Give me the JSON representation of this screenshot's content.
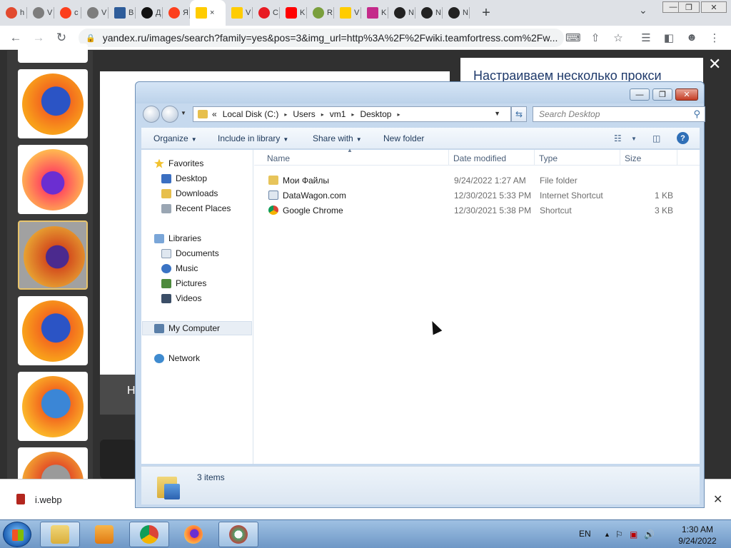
{
  "browser": {
    "tabs": [
      {
        "icon": "habr-icon",
        "label": "h",
        "color": "#e24a2f"
      },
      {
        "icon": "globe-icon",
        "label": "V",
        "color": "#555"
      },
      {
        "icon": "yandex-icon",
        "label": "c",
        "color": "#fc3f1d"
      },
      {
        "icon": "globe-icon",
        "label": "V",
        "color": "#555"
      },
      {
        "icon": "app-icon",
        "label": "B",
        "color": "#2e5c9a"
      },
      {
        "icon": "plus-circle-icon",
        "label": "Д",
        "color": "#111"
      },
      {
        "icon": "yandex-icon",
        "label": "Я",
        "color": "#fc3f1d"
      },
      {
        "icon": "images-icon",
        "label": "×",
        "color": "#ffcc00",
        "active": true
      },
      {
        "icon": "images-icon",
        "label": "V",
        "color": "#ffcc00"
      },
      {
        "icon": "opera-icon",
        "label": "C",
        "color": "#e81b23"
      },
      {
        "icon": "youtube-icon",
        "label": "K",
        "color": "#ff0000"
      },
      {
        "icon": "roblox-icon",
        "label": "R",
        "color": "#7a9f3d"
      },
      {
        "icon": "images-icon",
        "label": "V",
        "color": "#ffcc00"
      },
      {
        "icon": "gl-icon",
        "label": "K",
        "color": "#c42a8a"
      },
      {
        "icon": "github-icon",
        "label": "N",
        "color": "#222"
      },
      {
        "icon": "github-icon",
        "label": "N",
        "color": "#222"
      },
      {
        "icon": "github-icon",
        "label": "N",
        "color": "#222"
      }
    ],
    "new_tab": "+",
    "tab_search": "⌄",
    "window_controls": {
      "minimize": "—",
      "maximize": "❐",
      "close": "✕"
    },
    "nav": {
      "back": "←",
      "forward": "→",
      "reload": "↻"
    },
    "url": "yandex.ru/images/search?family=yes&pos=3&img_url=http%3A%2F%2Fwiki.teamfortress.com%2Fw..."
  },
  "page": {
    "right_title": "Настраиваем несколько прокси",
    "preview_letter": "Н",
    "close_viewer": "✕"
  },
  "download": {
    "file_name": "i.webp",
    "close": "✕"
  },
  "explorer": {
    "caption_buttons": {
      "minimize": "—",
      "maximize": "❐",
      "close": "✕"
    },
    "breadcrumb": {
      "overflow": "«",
      "parts": [
        "Local Disk (C:)",
        "Users",
        "vm1",
        "Desktop"
      ],
      "separator": "▸"
    },
    "search_placeholder": "Search Desktop",
    "commands": {
      "organize": "Organize",
      "include_in_library": "Include in library",
      "share_with": "Share with",
      "new_folder": "New folder"
    },
    "nav_pane": {
      "favorites": "Favorites",
      "desktop": "Desktop",
      "downloads": "Downloads",
      "recent_places": "Recent Places",
      "libraries": "Libraries",
      "documents": "Documents",
      "music": "Music",
      "pictures": "Pictures",
      "videos": "Videos",
      "my_computer": "My Computer",
      "network": "Network"
    },
    "columns": {
      "name": "Name",
      "date": "Date modified",
      "type": "Type",
      "size": "Size"
    },
    "files": [
      {
        "name": "Мои Файлы",
        "date": "9/24/2022 1:27 AM",
        "type": "File folder",
        "size": "",
        "icon": "folder-icon"
      },
      {
        "name": "DataWagon.com",
        "date": "12/30/2021 5:33 PM",
        "type": "Internet Shortcut",
        "size": "1 KB",
        "icon": "internet-shortcut-icon"
      },
      {
        "name": "Google Chrome",
        "date": "12/30/2021 5:38 PM",
        "type": "Shortcut",
        "size": "3 KB",
        "icon": "chrome-shortcut-icon"
      }
    ],
    "status": "3 items"
  },
  "taskbar": {
    "lang": "EN",
    "time": "1:30 AM",
    "date": "9/24/2022"
  }
}
